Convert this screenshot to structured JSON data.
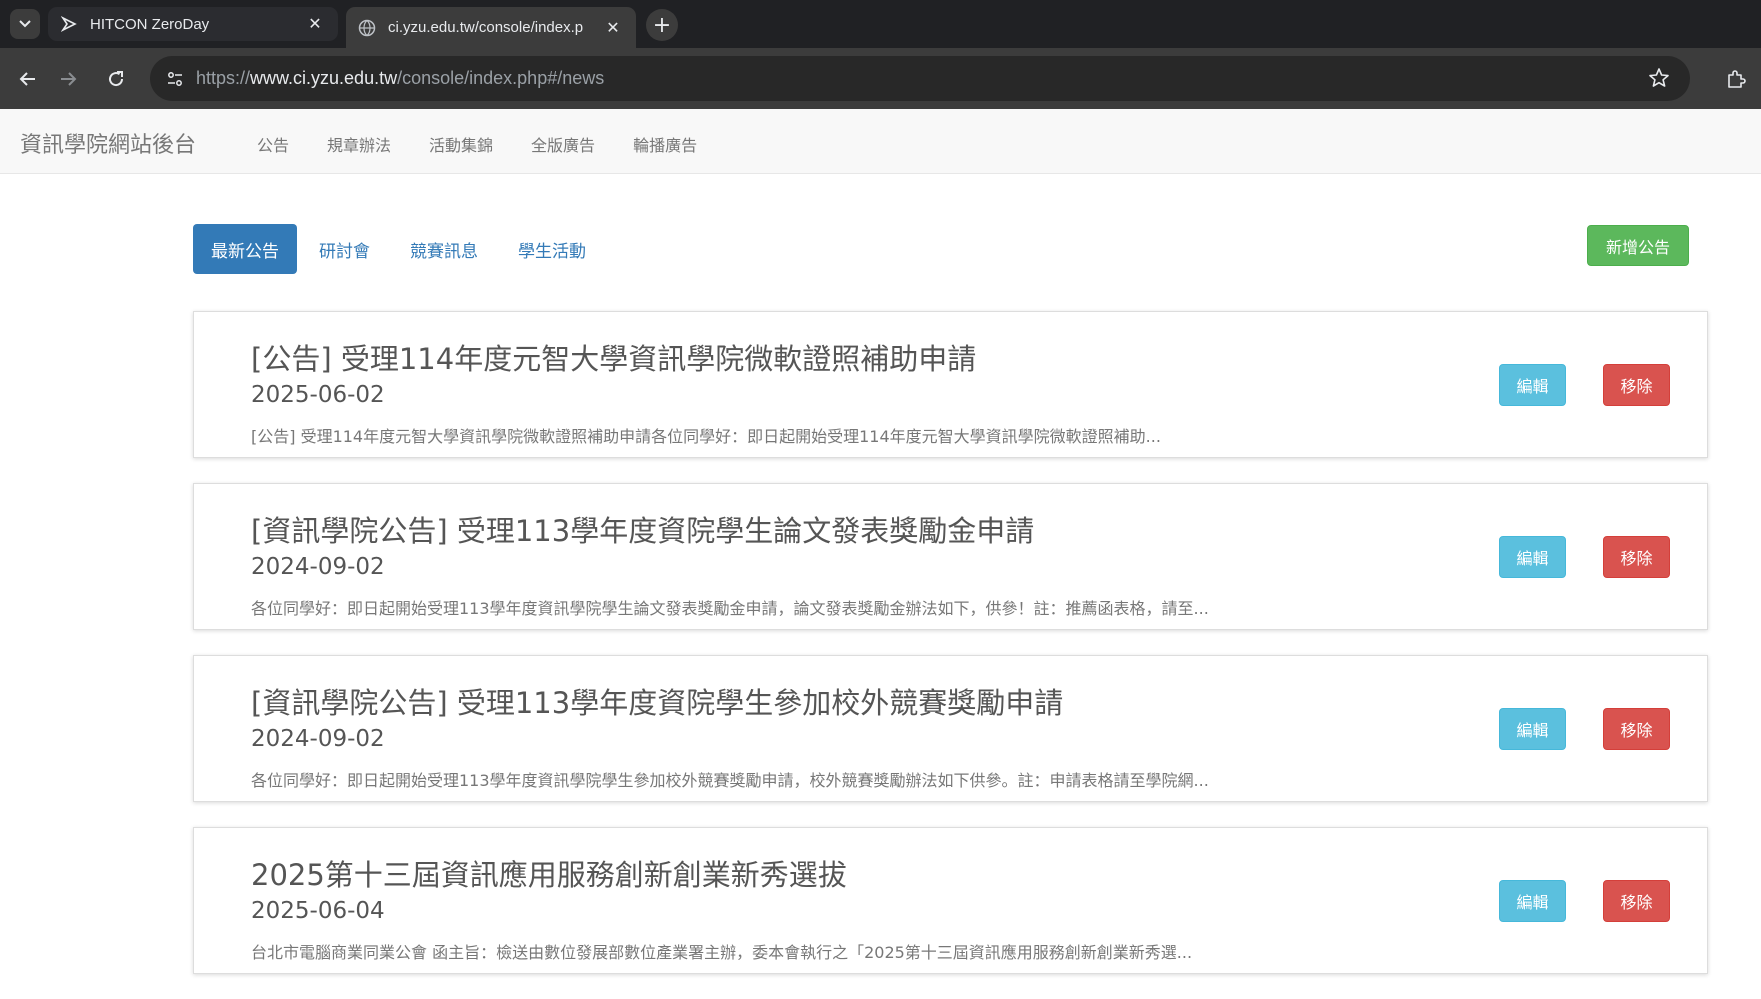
{
  "browser": {
    "tabs": [
      {
        "title": "HITCON ZeroDay",
        "icon": "hitcon-favicon",
        "active": false
      },
      {
        "title": "ci.yzu.edu.tw/console/index.p",
        "icon": "globe-icon",
        "active": true
      }
    ],
    "url_prefix": "https://",
    "url_host": "www.ci.yzu.edu.tw",
    "url_path": "/console/index.php#/news"
  },
  "navbar": {
    "brand": "資訊學院網站後台",
    "links": [
      "公告",
      "規章辦法",
      "活動集錦",
      "全版廣告",
      "輪播廣告"
    ]
  },
  "categories": {
    "tabs": [
      "最新公告",
      "研討會",
      "競賽訊息",
      "學生活動"
    ],
    "active_index": 0,
    "add_button": "新增公告"
  },
  "news": [
    {
      "title": "[公告] 受理114年度元智大學資訊學院微軟證照補助申請",
      "date": "2025-06-02",
      "summary": "[公告] 受理114年度元智大學資訊學院微軟證照補助申請各位同學好：即日起開始受理114年度元智大學資訊學院微軟證照補助...",
      "edit_label": "編輯",
      "remove_label": "移除"
    },
    {
      "title": "[資訊學院公告] 受理113學年度資院學生論文發表獎勵金申請",
      "date": "2024-09-02",
      "summary": "各位同學好：即日起開始受理113學年度資訊學院學生論文發表獎勵金申請，論文發表獎勵金辦法如下，供參！註：推薦函表格，請至...",
      "edit_label": "編輯",
      "remove_label": "移除"
    },
    {
      "title": "[資訊學院公告] 受理113學年度資院學生參加校外競賽獎勵申請",
      "date": "2024-09-02",
      "summary": "各位同學好：即日起開始受理113學年度資訊學院學生參加校外競賽獎勵申請，校外競賽獎勵辦法如下供參。註：申請表格請至學院網...",
      "edit_label": "編輯",
      "remove_label": "移除"
    },
    {
      "title": "2025第十三屆資訊應用服務創新創業新秀選拔",
      "date": "2025-06-04",
      "summary": "台北市電腦商業同業公會 函主旨：檢送由數位發展部數位產業署主辦，委本會執行之「2025第十三屆資訊應用服務創新創業新秀選...",
      "edit_label": "編輯",
      "remove_label": "移除"
    }
  ],
  "colors": {
    "primary": "#337ab7",
    "success": "#5cb85c",
    "info": "#5bc0de",
    "danger": "#d9534f"
  }
}
